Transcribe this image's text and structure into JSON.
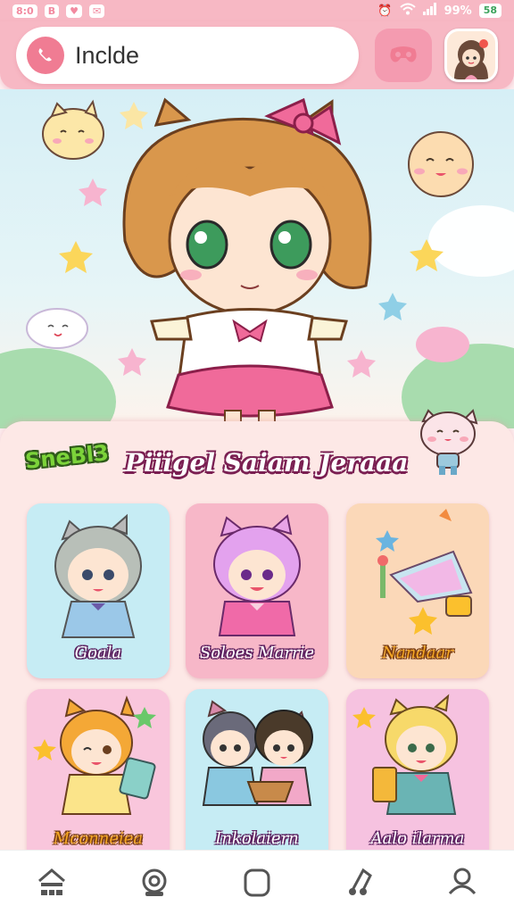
{
  "statusbar": {
    "left_items": [
      "8:0",
      "B",
      "♥",
      "✉"
    ],
    "signal_text": "99%",
    "battery_text": "58"
  },
  "search": {
    "value": "Inclde"
  },
  "panel": {
    "badge": "SneBl3",
    "title": "Piiigel Saiam Jeraaa"
  },
  "cards": [
    {
      "label": "Goala",
      "style": "purple"
    },
    {
      "label": "Soloes Marrie",
      "style": "purple"
    },
    {
      "label": "Nandaar",
      "style": "orange"
    },
    {
      "label": "Mconneiea",
      "style": "orange"
    },
    {
      "label": "Inkolaiern",
      "style": "purple"
    },
    {
      "label": "Aalo ilarma",
      "style": "purple"
    }
  ],
  "bottomnav": [
    "home-icon",
    "settings-icon",
    "square-icon",
    "music-icon",
    "profile-icon"
  ],
  "colors": {
    "header": "#f7b8c4",
    "accent": "#f07c93",
    "panel": "#fde8e6"
  }
}
